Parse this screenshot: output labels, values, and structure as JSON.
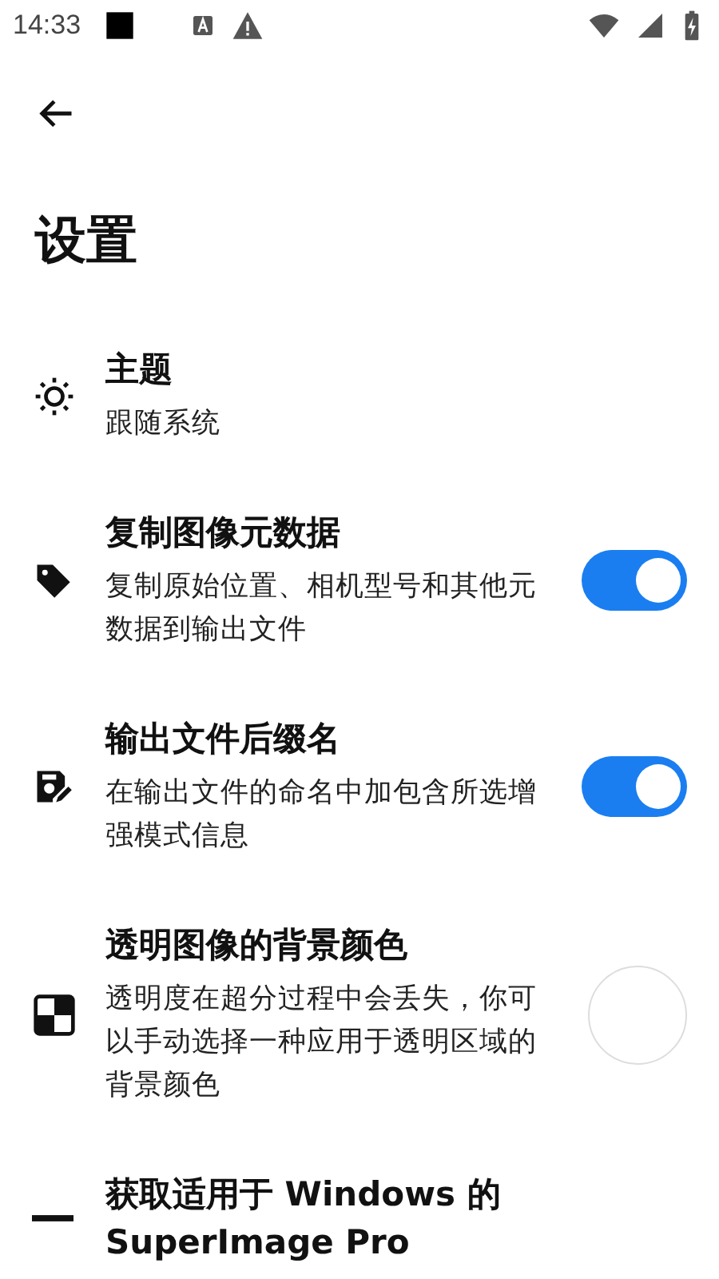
{
  "status_bar": {
    "time": "14:33"
  },
  "page": {
    "title": "设置"
  },
  "settings": [
    {
      "kind": "plain",
      "title": "主题",
      "subtitle": "跟随系统"
    },
    {
      "kind": "toggle",
      "title": "复制图像元数据",
      "subtitle": "复制原始位置、相机型号和其他元数据到输出文件",
      "on": true
    },
    {
      "kind": "toggle",
      "title": "输出文件后缀名",
      "subtitle": "在输出文件的命名中加包含所选增强模式信息",
      "on": true
    },
    {
      "kind": "color",
      "title": "透明图像的背景颜色",
      "subtitle": "透明度在超分过程中会丢失，你可以手动选择一种应用于透明区域的背景颜色",
      "color": "#ffffff"
    },
    {
      "kind": "plain",
      "title": "获取适用于 Windows 的 SuperImage Pro"
    }
  ]
}
